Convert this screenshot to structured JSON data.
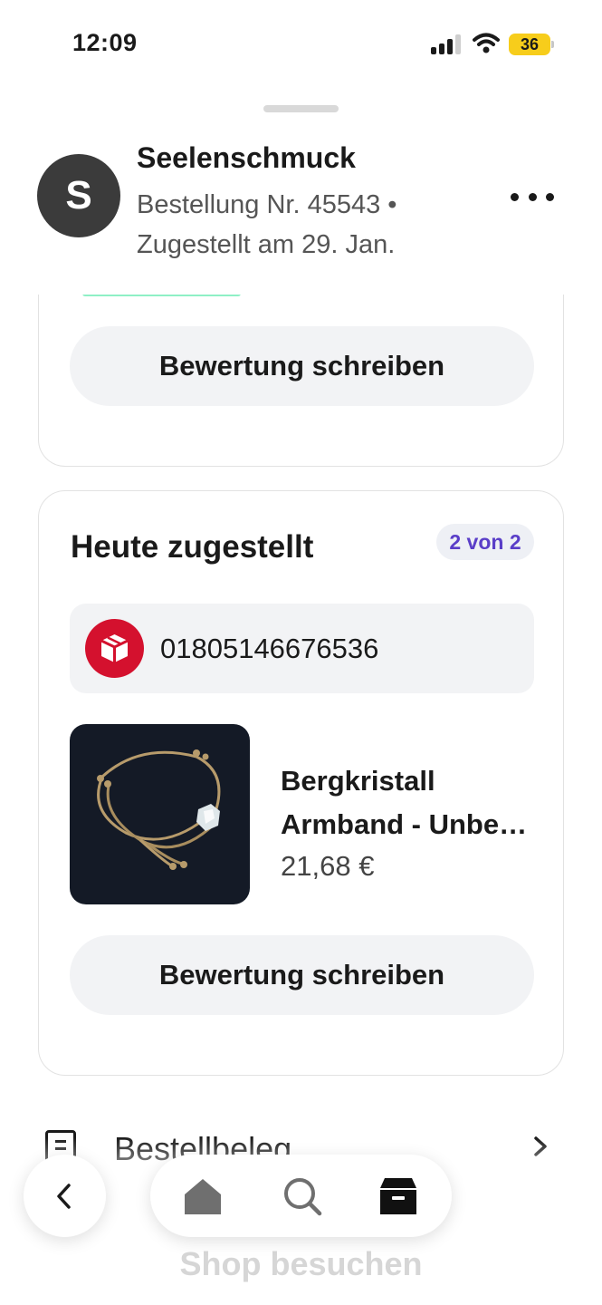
{
  "status_bar": {
    "time": "12:09",
    "battery": "36"
  },
  "header": {
    "avatar_letter": "S",
    "shop_name": "Seelenschmuck",
    "order_info": "Bestellung Nr. 45543 • Zugestellt am 29. Jan."
  },
  "top_card": {
    "review_button": "Bewertung schreiben"
  },
  "shipment_card": {
    "title": "Heute zugestellt",
    "count_badge": "2 von 2",
    "carrier_icon": "dhl-parcel-icon",
    "tracking_number": "01805146676536",
    "product": {
      "title_line1": "Bergkristall",
      "title_line2": "Armband - Unbehandelt",
      "price": "21,68 €"
    },
    "review_button": "Bewertung schreiben"
  },
  "receipt_row": {
    "label": "Bestellbeleg"
  },
  "footer": {
    "shop_visit": "Shop besuchen"
  },
  "bottom_nav": {
    "items": [
      "home-icon",
      "search-icon",
      "orders-box-icon"
    ],
    "back": "back-chevron-icon"
  },
  "colors": {
    "accent_purple": "#5a3ec8",
    "dhl_red": "#d4112e",
    "battery_yellow": "#f7cd1b"
  }
}
